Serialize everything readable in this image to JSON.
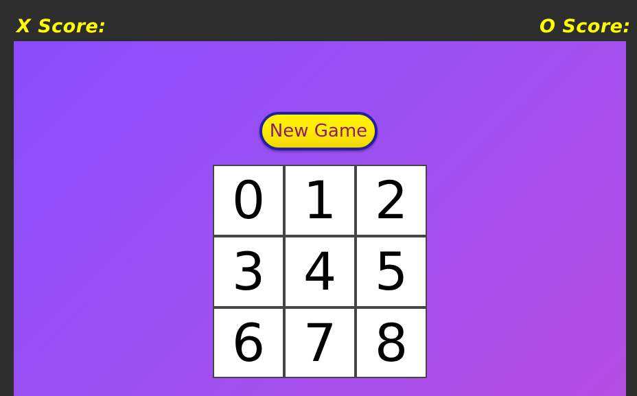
{
  "scoreboard": {
    "x_score_label": "X Score:",
    "o_score_label": "O Score:",
    "label_color": "#ffff00",
    "frame_color": "#2d2d2d"
  },
  "controls": {
    "new_game_label": "New Game",
    "button_fill": "#ffee00",
    "button_border": "#2222a0",
    "button_text_color": "#8e1a6e"
  },
  "board": {
    "rows": 3,
    "columns": 3,
    "cells": [
      {
        "label": "0"
      },
      {
        "label": "1"
      },
      {
        "label": "2"
      },
      {
        "label": "3"
      },
      {
        "label": "4"
      },
      {
        "label": "5"
      },
      {
        "label": "6"
      },
      {
        "label": "7"
      },
      {
        "label": "8"
      }
    ],
    "cell_background": "#ffffff",
    "cell_border": "#454545",
    "cell_text_color": "#000000"
  },
  "play_area": {
    "gradient_start": "#8b4cfc",
    "gradient_end": "#b64ee2"
  }
}
